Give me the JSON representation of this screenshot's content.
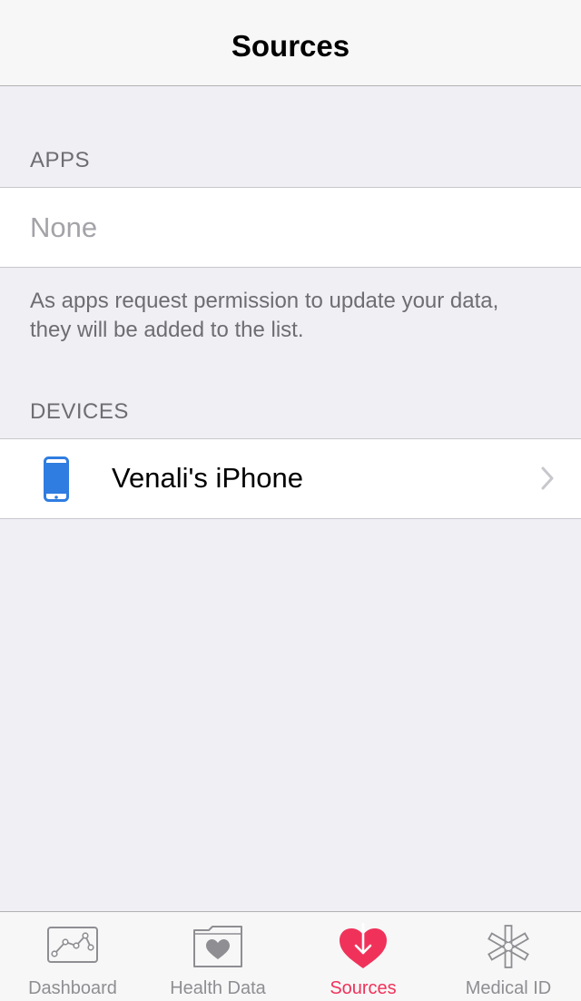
{
  "navbar": {
    "title": "Sources"
  },
  "apps_section": {
    "header": "APPS",
    "empty_label": "None",
    "footer": "As apps request permission to update your data, they will be added to the list."
  },
  "devices_section": {
    "header": "DEVICES",
    "items": [
      {
        "label": "Venali's iPhone",
        "icon": "iphone-icon"
      }
    ]
  },
  "tabbar": {
    "tabs": [
      {
        "label": "Dashboard",
        "icon": "dashboard-chart-icon",
        "active": false
      },
      {
        "label": "Health Data",
        "icon": "health-data-folder-icon",
        "active": false
      },
      {
        "label": "Sources",
        "icon": "sources-heart-icon",
        "active": true
      },
      {
        "label": "Medical ID",
        "icon": "medical-id-asterisk-icon",
        "active": false
      }
    ]
  },
  "colors": {
    "accent": "#f0325a",
    "device_icon": "#2f7de1",
    "inactive": "#8e8e93",
    "background": "#efeff4"
  }
}
